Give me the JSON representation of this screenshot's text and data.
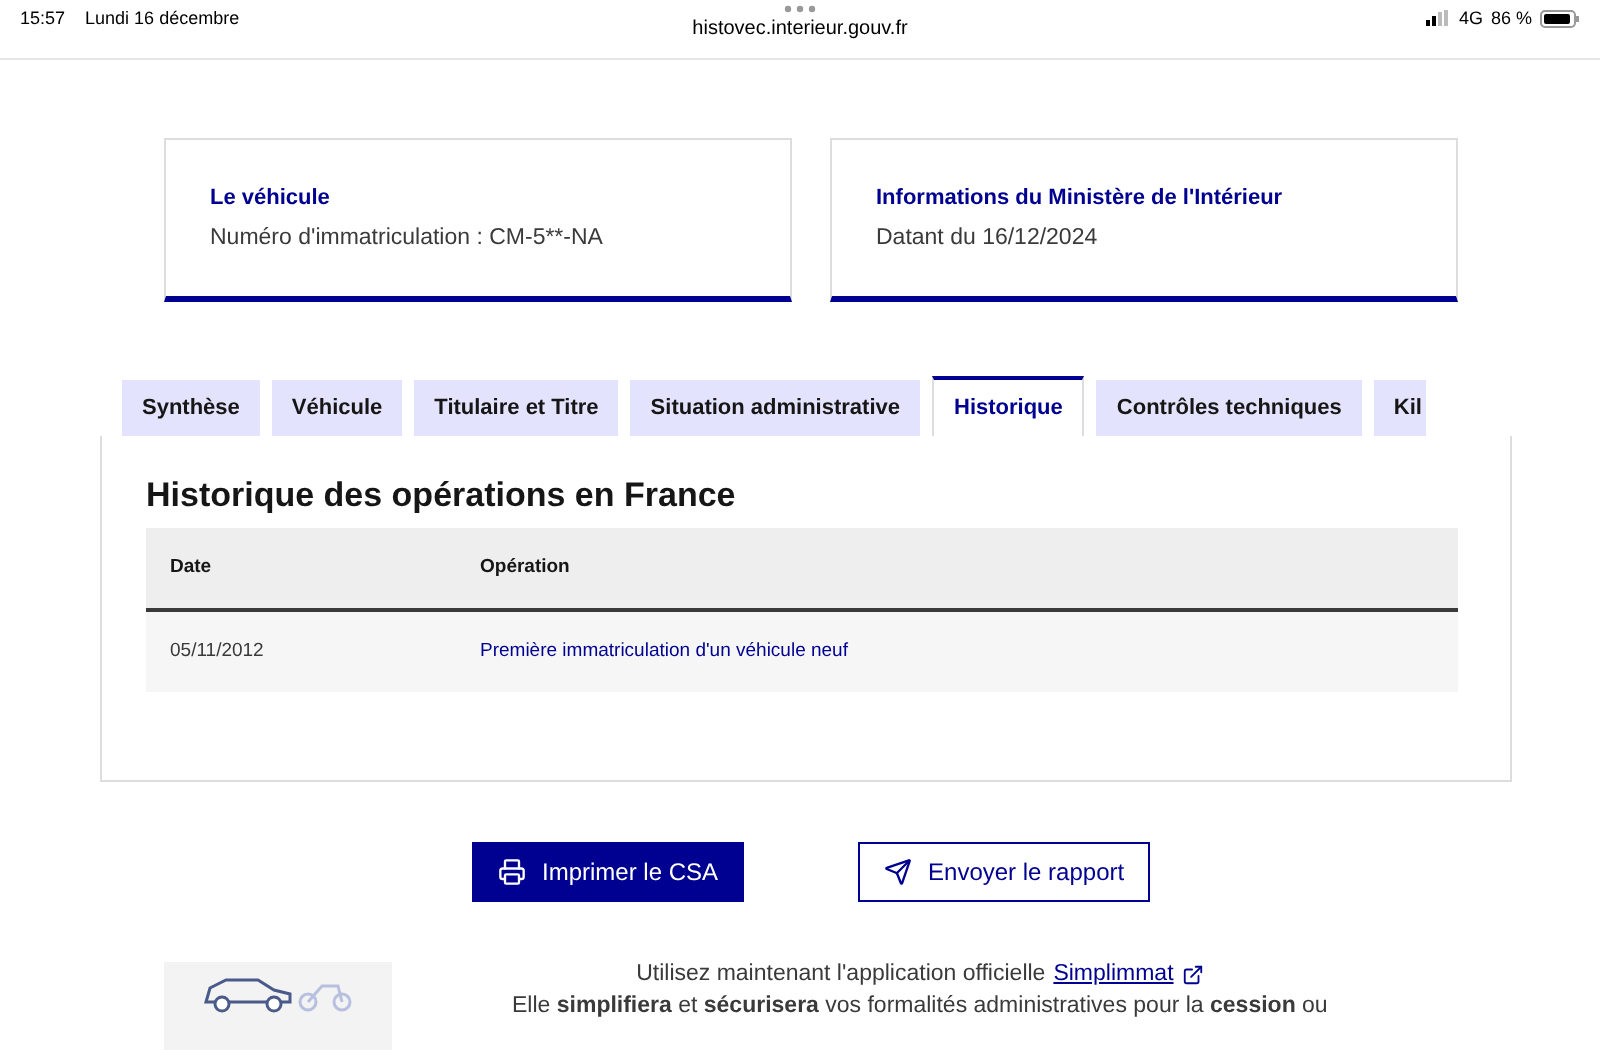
{
  "status_bar": {
    "time": "15:57",
    "date": "Lundi 16 décembre",
    "url": "histovec.interieur.gouv.fr",
    "network": "4G",
    "battery": "86 %"
  },
  "cards": [
    {
      "title": "Le véhicule",
      "text": "Numéro d'immatriculation : CM-5**-NA"
    },
    {
      "title": "Informations du Ministère de l'Intérieur",
      "text": "Datant du 16/12/2024"
    }
  ],
  "tabs": [
    {
      "label": "Synthèse",
      "selected": false
    },
    {
      "label": "Véhicule",
      "selected": false
    },
    {
      "label": "Titulaire et Titre",
      "selected": false
    },
    {
      "label": "Situation administrative",
      "selected": false
    },
    {
      "label": "Historique",
      "selected": true
    },
    {
      "label": "Contrôles techniques",
      "selected": false
    },
    {
      "label": "Kil",
      "selected": false
    }
  ],
  "panel": {
    "title": "Historique des opérations en France",
    "table": {
      "columns": [
        "Date",
        "Opération"
      ],
      "rows": [
        [
          "05/11/2012",
          "Première immatriculation d'un véhicule neuf"
        ]
      ]
    }
  },
  "buttons": [
    {
      "label": "Imprimer le CSA",
      "kind": "primary"
    },
    {
      "label": "Envoyer le rapport",
      "kind": "secondary"
    }
  ],
  "promo": {
    "line1": "Utilisez maintenant l'application officielle",
    "link": "Simplimmat",
    "line2": "Elle **simplifiera** et **sécurisera** vos formalités administratives pour la **cession** ou"
  }
}
